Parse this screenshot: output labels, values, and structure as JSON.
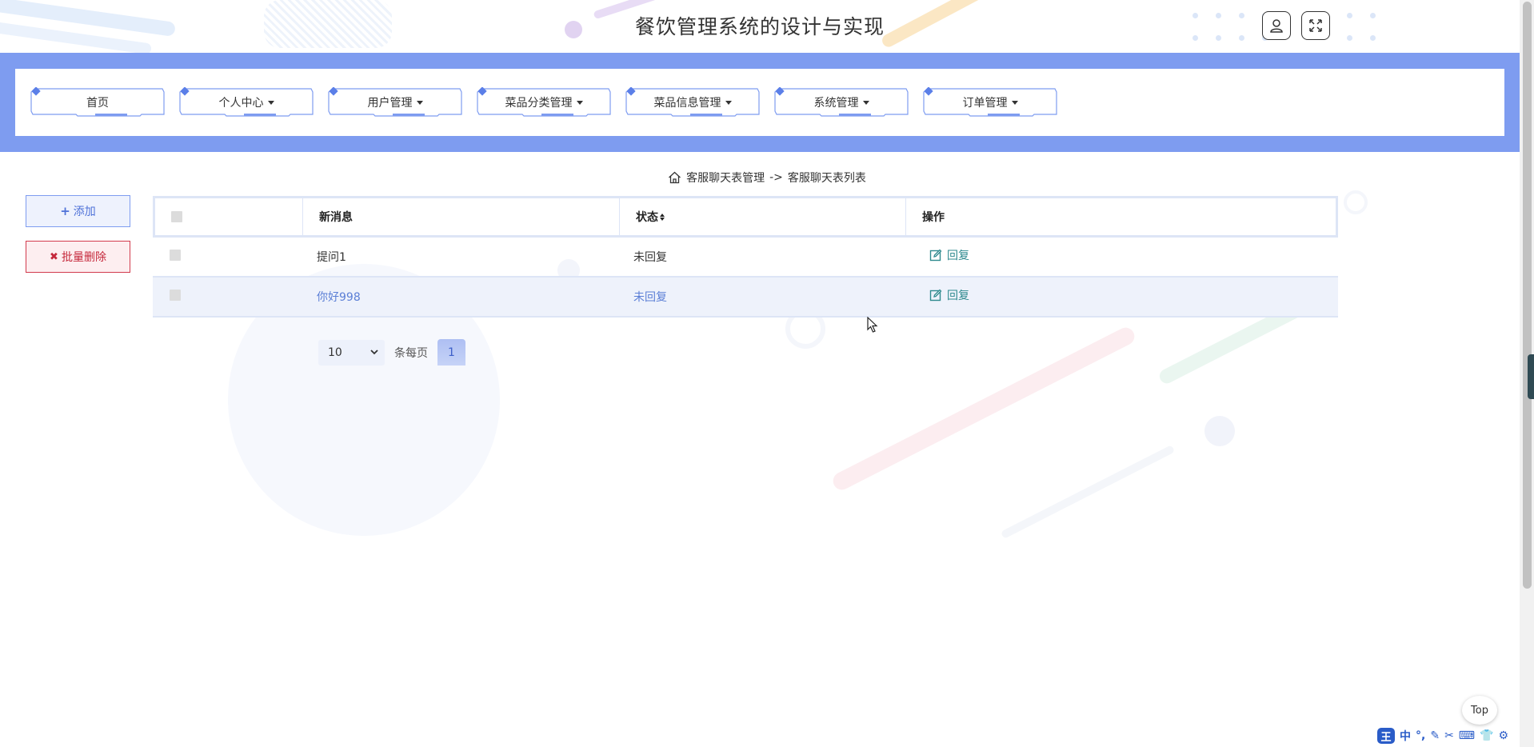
{
  "header": {
    "title": "餐饮管理系统的设计与实现",
    "icons": [
      "user-icon",
      "fullscreen-icon"
    ]
  },
  "nav": {
    "items": [
      {
        "label": "首页",
        "dropdown": false
      },
      {
        "label": "个人中心",
        "dropdown": true
      },
      {
        "label": "用户管理",
        "dropdown": true
      },
      {
        "label": "菜品分类管理",
        "dropdown": true
      },
      {
        "label": "菜品信息管理",
        "dropdown": true
      },
      {
        "label": "系统管理",
        "dropdown": true
      },
      {
        "label": "订单管理",
        "dropdown": true
      }
    ]
  },
  "breadcrumb": {
    "parent": "客服聊天表管理",
    "separator": "->",
    "current": "客服聊天表列表"
  },
  "actions": {
    "add_label": "添加",
    "batch_delete_label": "批量删除"
  },
  "table": {
    "columns": [
      "新消息",
      "状态",
      "操作"
    ],
    "rows": [
      {
        "message": "提问1",
        "status": "未回复",
        "action": "回复"
      },
      {
        "message": "你好998",
        "status": "未回复",
        "action": "回复"
      }
    ]
  },
  "pagination": {
    "page_size": "10",
    "per_page_label": "条每页",
    "current_page": "1"
  },
  "misc": {
    "top_label": "Top",
    "ime_label": "中",
    "ime_logo": "王"
  },
  "colors": {
    "accent": "#7e9cf0",
    "danger": "#c5283b",
    "link": "#2f8a8f"
  }
}
